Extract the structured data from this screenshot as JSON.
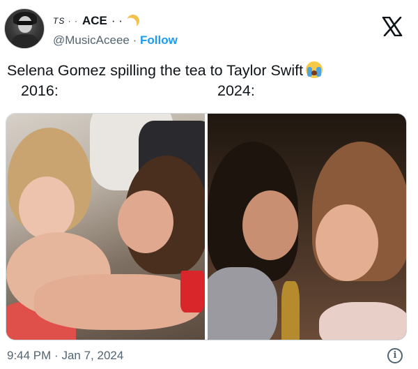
{
  "author": {
    "name_prefix": "TS · ·",
    "display_name": "ACE",
    "name_suffix": "· ·",
    "handle": "@MusicAceee",
    "separator": "·",
    "follow_label": "Follow"
  },
  "tweet": {
    "text": "Selena Gomez spilling the tea to Taylor Swift",
    "left_label": "2016:",
    "right_label": "2024:"
  },
  "meta": {
    "time": "9:44 PM",
    "separator": "·",
    "date": "Jan 7, 2024",
    "info_glyph": "i"
  },
  "icons": {
    "platform": "x-logo-icon",
    "emoji": "crying-face-icon",
    "name_emoji": "crescent-moon-icon"
  },
  "colors": {
    "link": "#1d9bf0",
    "secondary_text": "#536471",
    "primary_text": "#0f1419"
  }
}
